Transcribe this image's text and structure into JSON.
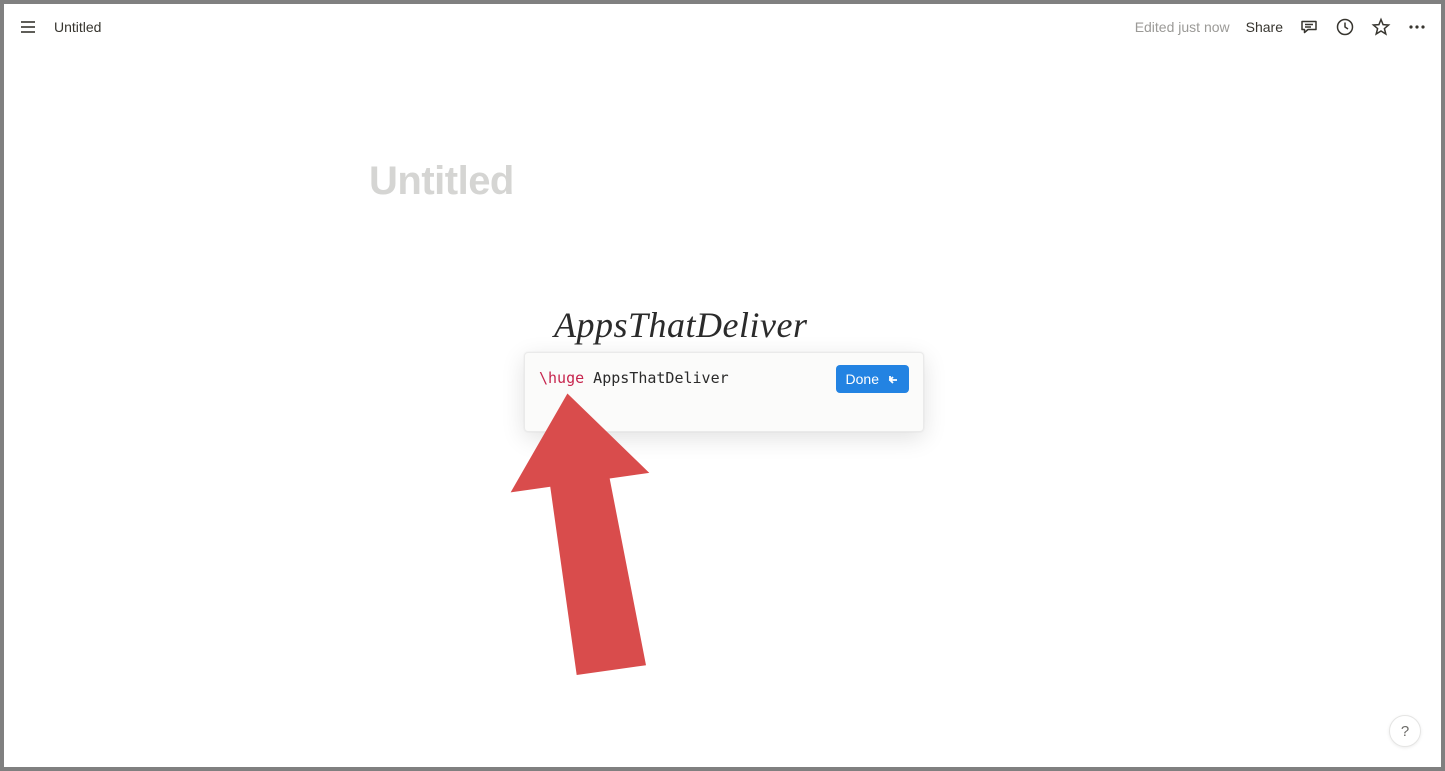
{
  "topbar": {
    "doc_title": "Untitled",
    "status": "Edited just now",
    "share": "Share"
  },
  "page": {
    "title_placeholder": "Untitled"
  },
  "equation": {
    "rendered": "AppsThatDeliver",
    "cmd_token": "\\huge",
    "text_token": " AppsThatDeliver",
    "done_label": "Done"
  },
  "help": {
    "label": "?"
  },
  "colors": {
    "accent": "#2383e2",
    "cmd": "#c7254e",
    "arrow": "#d94c4c"
  }
}
